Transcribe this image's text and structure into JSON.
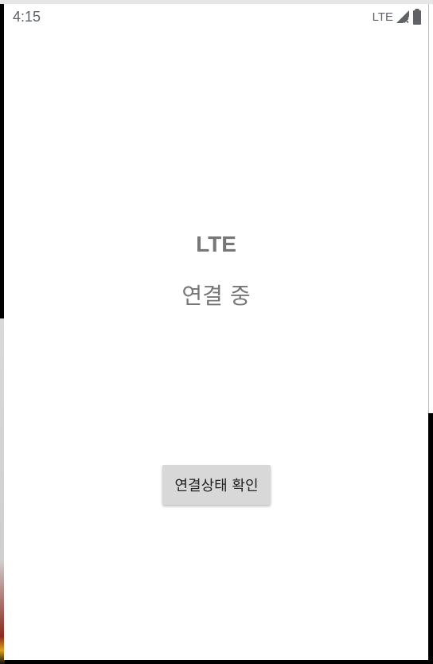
{
  "status_bar": {
    "time": "4:15",
    "network_label": "LTE",
    "icons": [
      "signal-no-data-icon",
      "battery-full-icon"
    ]
  },
  "main": {
    "network_type": "LTE",
    "connection_status": "연결 중",
    "check_button_label": "연결상태 확인"
  },
  "colors": {
    "background": "#ffffff",
    "status_text": "#5f6368",
    "main_text": "#777777",
    "button_bg": "#d8d8d8",
    "button_text": "#222222"
  }
}
